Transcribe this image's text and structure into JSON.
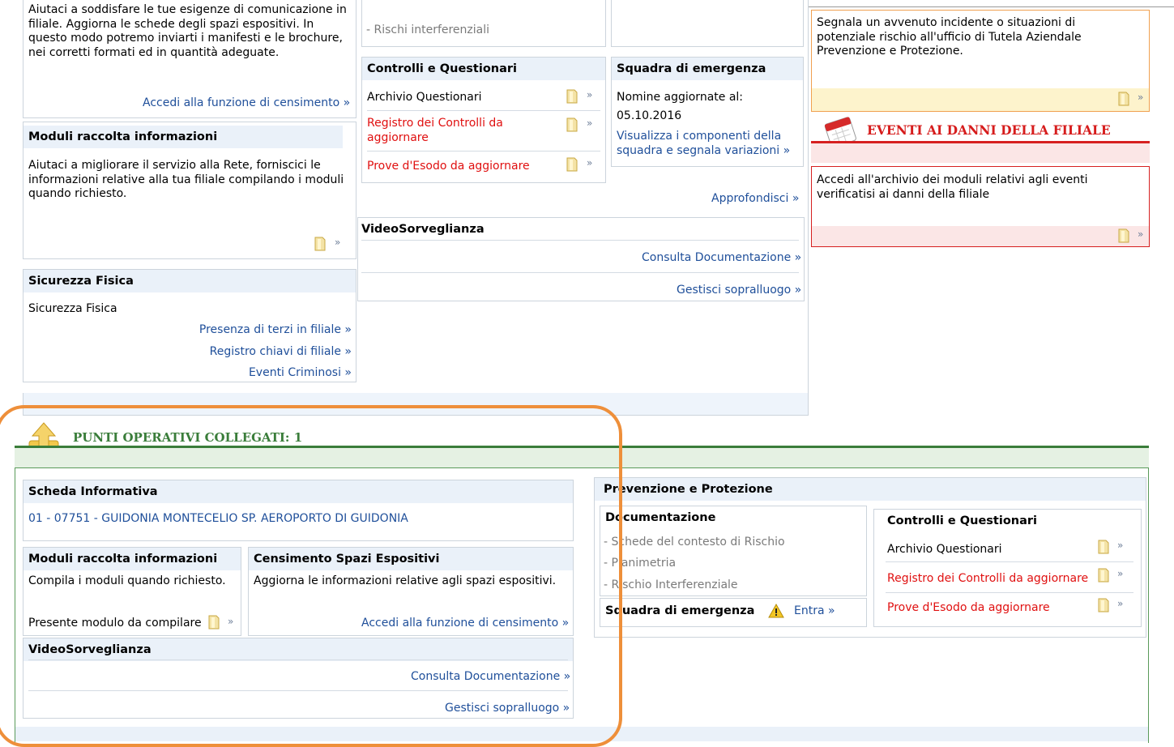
{
  "left_top": {
    "census_text": "Aiutaci a soddisfare le tue esigenze di comunicazione in filiale. Aggiorna le schede degli spazi espositivi. In questo modo potremo inviarti i manifesti e le brochure, nei corretti formati ed in quantità adeguate.",
    "census_link": "Accedi alla funzione di censimento »",
    "moduli_title": "Moduli raccolta informazioni",
    "moduli_text": "Aiutaci a migliorare il servizio alla Rete, forniscici le informazioni relative alla tua filiale compilando i moduli quando richiesto.",
    "sicurezza_title": "Sicurezza Fisica",
    "sicurezza_text": "Sicurezza Fisica",
    "sicurezza_links": [
      "Presenza di terzi in filiale »",
      "Registro chiavi di filiale »",
      "Eventi Criminosi »"
    ]
  },
  "middle_top": {
    "rischi": "- Rischi interferenziali",
    "controlli_title": "Controlli e Questionari",
    "controlli_items": [
      "Archivio Questionari",
      "Registro dei Controlli da aggiornare",
      "Prove d'Esodo da aggiornare"
    ],
    "squadra_title": "Squadra di emergenza",
    "nomine": "Nomine aggiornate al:",
    "nomine_date": "05.10.2016",
    "squadra_link": "Visualizza i componenti della squadra e segnala variazioni »",
    "approfondisci": "Approfondisci »",
    "video_title": "VideoSorveglianza",
    "video_links": [
      "Consulta Documentazione »",
      "Gestisci sopralluogo »"
    ]
  },
  "right_top": {
    "incidente_text": "Segnala un avvenuto incidente o situazioni di potenziale rischio all'ufficio di Tutela Aziendale Prevenzione e Protezione.",
    "eventi_title": "EVENTI AI DANNI DELLA FILIALE",
    "eventi_text": "Accedi all'archivio dei moduli relativi agli eventi verificatisi ai danni della filiale"
  },
  "punti": {
    "title": "PUNTI OPERATIVI COLLEGATI: 1",
    "scheda_title": "Scheda Informativa",
    "scheda_link": "01 - 07751 - GUIDONIA MONTECELIO SP. AEROPORTO DI GUIDONIA",
    "moduli_title": "Moduli raccolta informazioni",
    "moduli_text": "Compila i moduli quando richiesto.",
    "moduli_status": "Presente modulo da compilare",
    "censimento_title": "Censimento Spazi Espositivi",
    "censimento_text": "Aggiorna le informazioni relative agli spazi espositivi.",
    "censimento_link": "Accedi alla funzione di censimento »",
    "video_title": "VideoSorveglianza",
    "video_links": [
      "Consulta Documentazione »",
      "Gestisci sopralluogo »"
    ],
    "prev_title": "Prevenzione e Protezione",
    "doc_title": "Documentazione",
    "doc_items": [
      "- Schede del contesto di Rischio",
      "- Planimetria",
      "- Rischio Interferenziale"
    ],
    "squadra_title": "Squadra di emergenza",
    "entra": "Entra »",
    "controlli_title": "Controlli e Questionari",
    "controlli_items": [
      "Archivio Questionari",
      "Registro dei Controlli da aggiornare",
      "Prove d'Esodo da aggiornare"
    ]
  },
  "icons": {
    "doc": "document-icon",
    "warning": "warning-icon",
    "folder_up": "folder-up-icon",
    "calendar": "calendar-icon"
  },
  "colors": {
    "link": "#1f4f9a",
    "alert_red": "#e01010",
    "green_accent": "#3a7d3a",
    "orange_highlight": "#ee8f3a"
  }
}
